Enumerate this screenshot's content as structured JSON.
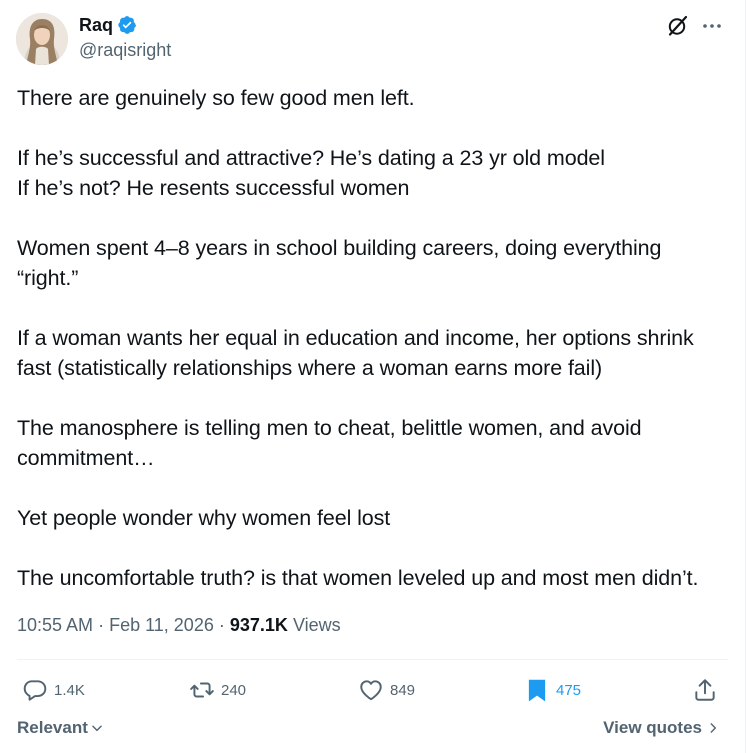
{
  "author": {
    "name": "Raq",
    "handle": "@raqisright",
    "verified_icon": "verified-badge-icon",
    "brand_color": "#1d9bf0"
  },
  "tweet": {
    "text": "There are genuinely so few good men left.\n\nIf he’s successful and attractive? He’s dating a 23 yr old model\nIf he’s not? He resents successful women\n\nWomen spent 4–8 years in school building careers, doing everything\n“right.”\n\nIf a woman wants her equal in education and income, her options shrink\nfast (statistically relationships where a woman earns more fail)\n\nThe manosphere is telling men to cheat, belittle women, and avoid\ncommitment…\n\nYet people wonder why women feel lost\n\nThe uncomfortable truth? is that women leveled up and most men didn’t.",
    "time": "10:55 AM",
    "date": "Feb 11, 2026",
    "separator": "·",
    "views_count": "937.1K",
    "views_label": "Views"
  },
  "actions": {
    "replies": "1.4K",
    "reposts": "240",
    "likes": "849",
    "bookmarks": "475"
  },
  "footer": {
    "sort_label": "Relevant",
    "view_quotes_label": "View quotes"
  }
}
